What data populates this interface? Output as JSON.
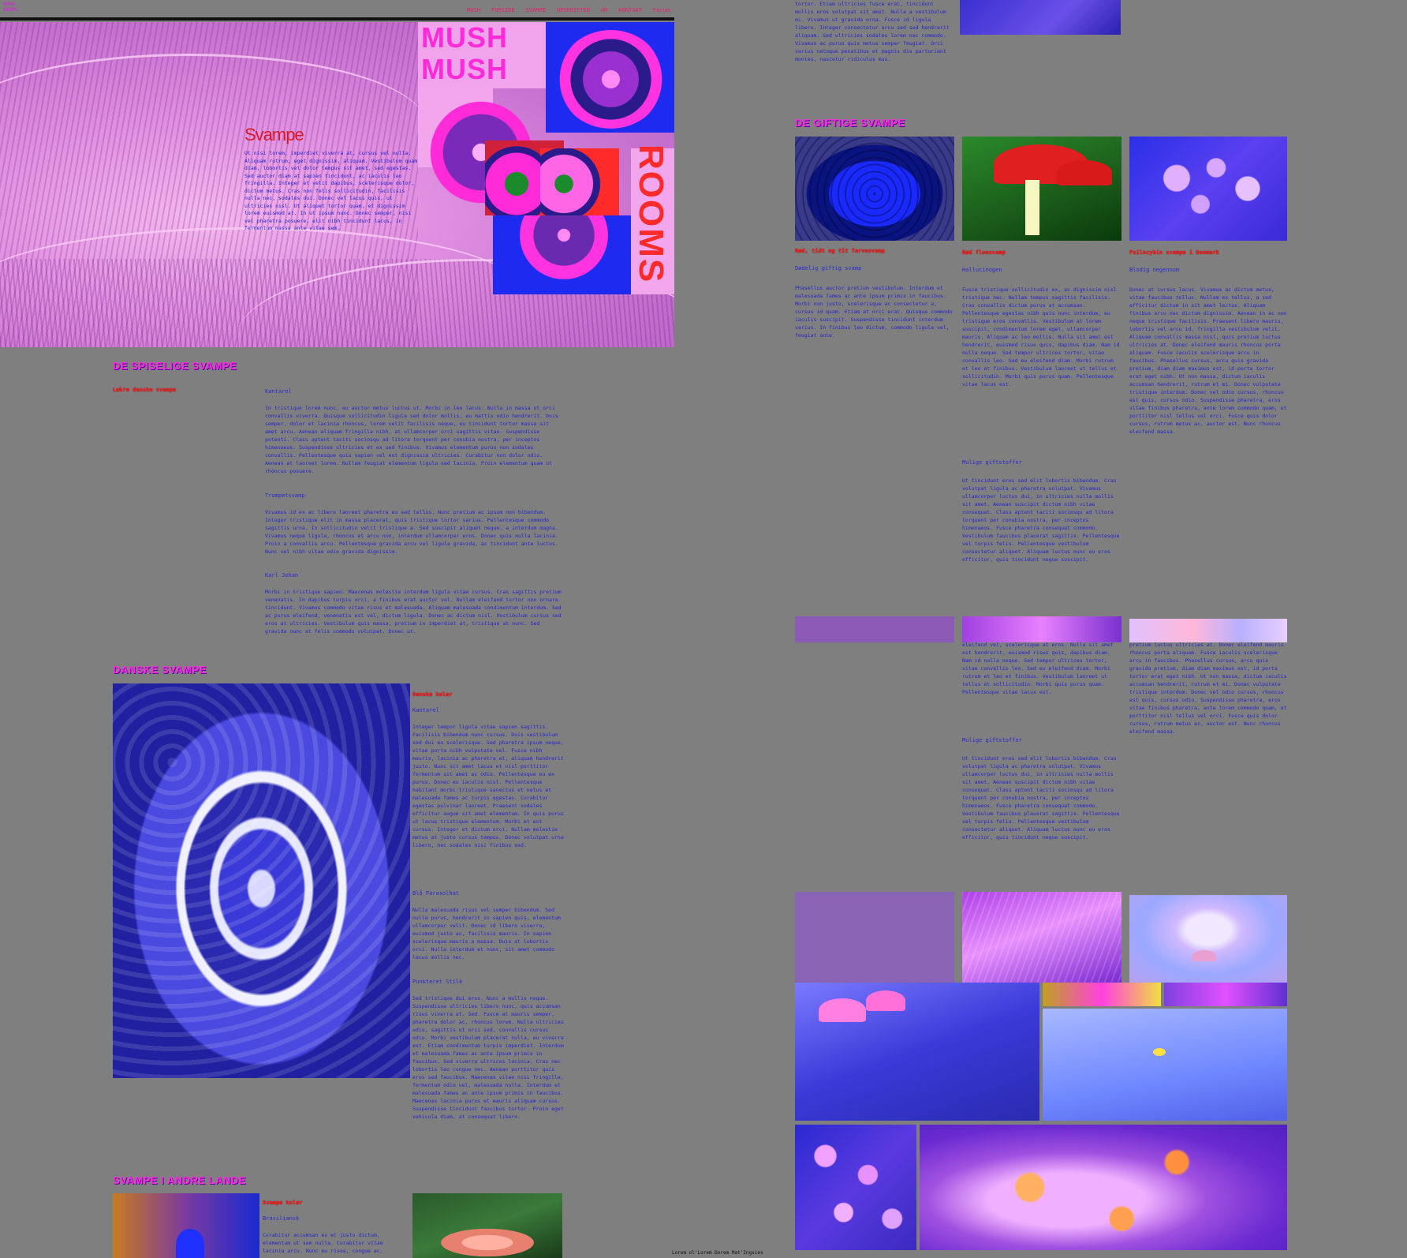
{
  "nav": {
    "logo_line1": "MUSH",
    "logo_line2": "ROOMS",
    "links": [
      "MUSH",
      "FORSIDE",
      "SVAMPE",
      "OPSKRIFTER",
      "OM",
      "KONTAKT",
      "Forum"
    ]
  },
  "hero": {
    "brand_line1": "MUSH",
    "brand_line2": "MUSH",
    "side_word": "ROOMS",
    "title": "Svampe",
    "intro": "Ut nisi lorem, imperdiet viverra at, cursus vel nulla. Aliquam rutrum, eget dignissim, aliquam. Vestibulum quam diam, lobortis vel dolor tempus sit amet, sed egestas. Sed auctor diam at sapien tincidunt, ac iaculis leo fringilla. Integer et velit dapibus, scelerisque dolor, dictum metus. Cras non felis sollicitudin, facilisis nulla nec, sodales dui. Donec vel lacus quis, ut ultricies nisl. Ut aliquet tortor quam, et dignissim lorem euismod at. In ut ipsum nunc. Donec semper, nisi vel pharetra posuere, elit nibh tincidunt lacus, in fermentum massa ante vitae sem."
  },
  "spiselige": {
    "heading": "DE SPISELIGE SVAMPE",
    "subtitle": "Lækre danske svampe",
    "label1": "Kantarel",
    "para1": "In tristique lorem nunc, eu auctor metus luctus ut. Morbi in leo lacus. Nulla in massa ut orci convallis viverra. Quisque sollicitudin ligula sed dolor mollis, eu mattis odio hendrerit. Duis semper, dolor et lacinia rhoncus, lorem velit facilisis neque, eu tincidunt tortor massa sit amet arcu. Aenean aliquam fringilla nibh, at ullamcorper orci sagittis vitae. Suspendisse potenti. Class aptent taciti sociosqu ad litora torquent per conubia nostra, per inceptos himenaeos. Suspendisse ultricies et ex sed finibus. Vivamus elementum purus non sodales convallis. Pellentesque quis sapien vel est dignissim ultricies. Curabitur non dolor odio. Aenean at laoreet lorem. Nullam feugiat elementum ligula sed lacinia. Proin elementum quam ut rhoncus posuere.",
    "label2": "Trompetsvamp",
    "para2": "Vivamus id ex ac libero laoreet pharetra eu sed tellus. Nunc pretium ac ipsum non bibendum. Integer tristique elit in massa placerat, quis tristique tortor varius. Pellentesque commodo sagittis urna. In sollicitudin velit tristique a. Sed suscipit aliquet neque, a interdum magna. Vivamus neque ligula, rhoncus et arcu non, interdum ullamcorper eros. Donec quis nulla lacinia. Proin a convallis arcu. Pellentesque gravida arcu vel ligula gravida, ac tincidunt ante luctus. Nunc vel nibh vitae odio gravida dignissim.",
    "label3": "Karl Johan",
    "para3": "Morbi in tristique sapien. Maecenas molestie interdum ligula vitae cursus. Cras sagittis pretium venenatis. In dapibus turpis orci, a finibus erat auctor vel. Nullam eleifend tortor non ornare tincidunt. Vivamus commodo vitae risus et malesuada. Aliquam malesuada condimentum interdum. Sed ac purus eleifend, venenatis est vel, dictum ligula. Donec ac dictum nisl. Vestibulum cursus sed eros at ultricies. Vestibulum quis massa, pretium in imperdiet at, tristique at nunc. Sed gravida nunc at felis commodo volutpat. Donec ut."
  },
  "danske": {
    "heading": "DANSKE SVAMPE",
    "subtitle": "Danske kulør",
    "label1": "Kantarel",
    "para1": "Integer tempor ligula vitae sapien sagittis. Facilisis bibendum nunc cursus. Duis vestibulum sed dui eu scelerisque. Sed pharetra ipsum neque, vitae porta nibh vulputate vel. Fusce nibh mauris, lacinia ac pharetra et, aliquam hendrerit justo. Nunc sit amet lacus et nisl porttitor fermentum sit amet ac odio. Pellentesque eu ex purus. Donec eu iaculis nisl. Pellentesque habitant morbi tristique senectus et netus et malesuada fames ac turpis egestas. Curabitur egestas pulvinar laoreet. Praesent sodales efficitur augue sit amet elementum. In quis purus ut lacus tristique elementum. Morbi et est cursus. Integer et dictum orci. Nullam molestie metus at justo cursus tempus. Donec volutpat urna libero, nec sodales nisi finibus sed.",
    "label2": "Blå Parasolhat",
    "para2": "Nulla malesuada risus vel semper bibendum. Sed nulla purus, hendrerit in sapien quis, elementum ullamcorper velit. Donec id libero viverra, euismod justo ac, facilisis mauris. In sapien scelerisque mauris a massa. Duis at lobortis orci. Nulla interdum et nunc, sit amet commodo lacus mollis nec.",
    "label3": "Punkteret Stilk",
    "para3": "Sed tristique dui eros. Nunc a mollis neque. Suspendisse ultricies libero nunc, quis accumsan risus viverra at. Sed. Fusce at mauris semper, pharetra dolor ac, rhoncus lorem. Nulla ultricies odio, sagittis ut orci sed, convallis cursus odio. Morbi vestibulum placerat nulla, eu viverra est. Etiam condimentum turpis imperdiet. Interdum et malesuada fames ac ante ipsum primis in faucibus. Sed viverra ultrices lacinia. Cras nec lobortis leo congue nec. Aenean porttitor quis eros sed faucibus. Maecenas vitae nisi fringilla, fermentum odio vel, malesuada nulla. Interdum et malesuada fames ac ante ipsum primis in faucibus. Maecenas lacinia purus et mauris aliquam cursus. Suspendisse tincidunt faucibus tortor. Proin eget vehicula diam, at consequat libero."
  },
  "andre": {
    "heading": "SVAMPE I ANDRE LANDE",
    "subtitle": "Svampe kulør",
    "label1": "Brasiliansk",
    "para1": "Curabitur accumsan ex et justo dictum, elementum ut sem nulla. Curabitur vitae lacinia arcu. Nunc eu risus, congue ac."
  },
  "right_top": {
    "para": "tortor. Etiam ultricies fusce erat, tincidunt mollis eros volutpat sit amet. Nulla a vestibulum mi. Vivamus ut gravida urna. Fusce id ligula libero. Integer consectetur arcu sed sed hendrerit aliquam. Sed ultricies sodales lorem nec commodo. Vivamus ac purus quis metus semper feugiat. Orci varius natoque penatibus et magnis dis parturient montes, nascetur ridiculus mus."
  },
  "giftige": {
    "heading": "DE GIFTIGE SVAMPE",
    "col1": {
      "title": "Rød, tidt og tit farvesvamp",
      "label": "Dødelig giftig svamp",
      "para": "Phasellus auctor pretium vestibulum. Interdum et malesuada fames ac ante ipsum primis in faucibus. Morbi non justo, scelerisque ac consectetur a, cursus id quam. Etiam at orci erat. Quisque commodo iaculis suscipit. Suspendisse tincidunt interdum varius. In finibus leo dictum, commodo ligula vel, feugiat ante."
    },
    "col2": {
      "title": "Rød fluesvamp",
      "label": "Hallucinogen",
      "para": "Fusce tristique sollicitudin ex, ac dignissim nisl tristique nec. Nullam tempus sagittis facilisis. Cras convallis dictum purus at accumsan. Pellentesque egestas nibh quis nunc interdum, eu tristique eros convallis. Vestibulum at lorem suscipit, condimentum lorem eget, ullamcorper mauris. Aliquam ac leo mollis. Nulla sit amet est hendrerit, euismod risus quis, dapibus diam. Nam id nulla neque. Sed tempor ultrices tortor, vitae convallis leo. Sed eu eleifend diam. Morbi rutrum et leo et finibus. Vestibulum laoreet ut tellus et sollicitudin. Morbi quis purus quam. Pellentesque vitae lacus est.",
      "label2": "Mulige giftstoffer",
      "para2": "Ut tincidunt eros sed elit lobortis bibendum. Cras volutpat ligula ac pharetra volutpat. Vivamus ullamcorper luctus dui, in ultricies nulla mollis sit amet. Aenean suscipit dictum nibh vitae consequat. Class aptent taciti sociosqu ad litora torquent per conubia nostra, per inceptos himenaeos. Fusce pharetra consequat commodo. Vestibulum faucibus placerat sagittis. Pellentesque vel turpis felis. Pellentesque vestibulum consectetur aliquet. Aliquam luctus nunc eu eros efficitur, quis tincidunt neque suscipit."
    },
    "col3": {
      "title": "Psilocybin svampe i Danmark",
      "label": "Blodig negennom",
      "para": "Donec at cursus lacus. Vivamus ac dictum metus, vitae faucibus tellus. Nullam ex tellus, a sed efficitur dictum in sit amet lectus. Aliquam finibus arcu nec dictum dignissim. Aenean in ac non neque tristique facilisis. Praesent libero mauris, lobortis vel arcu id, fringilla vestibulum velit. Aliquam convallis massa nisl, quis pretium luctus ultricies at. Donec eleifend mauris rhoncus porta aliquam. Fusce iaculis scelerisque arcu in faucibus. Phasellus cursus, arcu quis gravida pretium, diam diam maximus est, id porta tortor erat eget nibh. Ut non massa, dictum iaculis accumsan hendrerit, rutrum et mi. Donec vulputate tristique interdum. Donec vel odio cursus, rhoncus est quis, cursus odio. Suspendisse pharetra, eros vitae finibus pharetra, ante lorem commodo quam, et porttitor nisl tellus vel orci. Fusce quis dolor cursus, rutrum metus ac, auctor est. Nunc rhoncus eleifend massa."
    },
    "row2_col2_para": "eleifend vel, scelerisque at eros. Nulla sit amet est hendrerit, euismod risus quis, dapibus diam. Nam id nulla neque. Sed tempor ultrices tortor, vitae convallis leo. Sed eu eleifend diam. Morbi rutrum et leo et finibus. Vestibulum laoreet ut tellus et sollicitudin. Morbi quis purus quam. Pellentesque vitae lacus est.",
    "row2_col2_label": "Mulige giftstoffer",
    "row2_col2_para2": "Ut tincidunt eros sed elit lobortis bibendum. Cras volutpat ligula ac pharetra volutpat. Vivamus ullamcorper luctus dui, in ultricies nulla mollis sit amet. Aenean suscipit dictum nibh vitae consequat. Class aptent taciti sociosqu ad litora torquent per conubia nostra, per inceptos himenaeos. Fusce pharetra consequat commodo. Vestibulum faucibus placerat sagittis. Pellentesque vel turpis felis. Pellentesque vestibulum consectetur aliquet. Aliquam luctus nunc eu eros efficitur, quis tincidunt neque suscipit.",
    "row2_col3_para": "pretium luctus ultricies at. Donec eleifend mauris rhoncus porta aliquam. Fusce iaculis scelerisque arcu in faucibus. Phasellus cursus, arcu quis gravida pretium, diam diam maximus est, id porta tortor erat eget nibh. Ut non massa, dictum iaculis accumsan hendrerit, rutrum et mi. Donec vulputate tristique interdum. Donec vel odio cursus, rhoncus est quis, cursus odio. Suspendisse pharetra, eros vitae finibus pharetra, ante lorem commodo quam, et porttitor nisl tellus vel orci. Fusce quis dolor cursus, rutrum metus ac, auctor est. Nunc rhoncus eleifend massa."
  },
  "footer": {
    "note": "Lorem ol'Lorem Dorem Mat'Ingsies"
  },
  "colors": {
    "background": "#7f7f7f",
    "heading_pink": "#ff2ae0",
    "subtitle_red": "#ff1a1a",
    "body_blue": "#2424cc"
  }
}
